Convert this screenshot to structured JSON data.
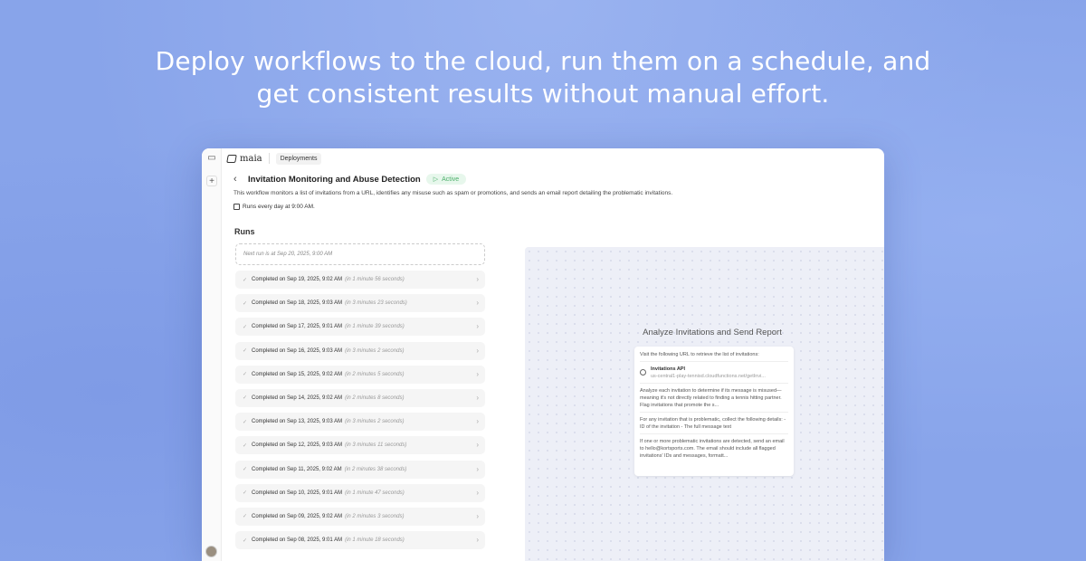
{
  "headline": {
    "line1": "Deploy workflows to the cloud, run them on a schedule, and",
    "line2": "get consistent results without manual effort."
  },
  "app": {
    "brand": "maia",
    "breadcrumb": "Deployments",
    "rail_icons": [
      "sidebar-toggle-icon",
      "plus-icon"
    ]
  },
  "workflow": {
    "title": "Invitation Monitoring and Abuse Detection",
    "status": "Active",
    "description": "This workflow monitors a list of invitations from a URL, identifies any misuse such as spam or promotions, and sends an email report detailing the problematic invitations.",
    "schedule": "Runs every day at 9:00 AM."
  },
  "runs": {
    "heading": "Runs",
    "next_run": "Next run is at Sep 20, 2025, 9:00 AM",
    "items": [
      {
        "label": "Completed on Sep 19, 2025, 9:02 AM",
        "duration": "(in 1 minute 56 seconds)"
      },
      {
        "label": "Completed on Sep 18, 2025, 9:03 AM",
        "duration": "(in 3 minutes 23 seconds)"
      },
      {
        "label": "Completed on Sep 17, 2025, 9:01 AM",
        "duration": "(in 1 minute 39 seconds)"
      },
      {
        "label": "Completed on Sep 16, 2025, 9:03 AM",
        "duration": "(in 3 minutes 2 seconds)"
      },
      {
        "label": "Completed on Sep 15, 2025, 9:02 AM",
        "duration": "(in 2 minutes 5 seconds)"
      },
      {
        "label": "Completed on Sep 14, 2025, 9:02 AM",
        "duration": "(in 2 minutes 8 seconds)"
      },
      {
        "label": "Completed on Sep 13, 2025, 9:03 AM",
        "duration": "(in 3 minutes 2 seconds)"
      },
      {
        "label": "Completed on Sep 12, 2025, 9:03 AM",
        "duration": "(in 3 minutes 11 seconds)"
      },
      {
        "label": "Completed on Sep 11, 2025, 9:02 AM",
        "duration": "(in 2 minutes 38 seconds)"
      },
      {
        "label": "Completed on Sep 10, 2025, 9:01 AM",
        "duration": "(in 1 minute 47 seconds)"
      },
      {
        "label": "Completed on Sep 09, 2025, 9:02 AM",
        "duration": "(in 2 minutes 3 seconds)"
      },
      {
        "label": "Completed on Sep 08, 2025, 9:01 AM",
        "duration": "(in 1 minute 18 seconds)"
      }
    ]
  },
  "node": {
    "title": "Analyze Invitations and Send Report",
    "step1": "Visit the following URL to retrieve the list of invitations:",
    "api_name": "Invitations API",
    "api_url": "us-central1-play-tennisd.cloudfunctions.net/getInvi...",
    "step2": "Analyze each invitation to determine if its message is misused—meaning it's not directly related to finding a tennis hitting partner. Flag invitations that promote the s...",
    "step3": "For any invitation that is problematic, collect the following details: - ID of the invitation - The full message text",
    "step4": "If one or more problematic invitations are detected, send an email to hello@kortsports.com. The email should include all flagged invitations' IDs and messages, formatt..."
  }
}
